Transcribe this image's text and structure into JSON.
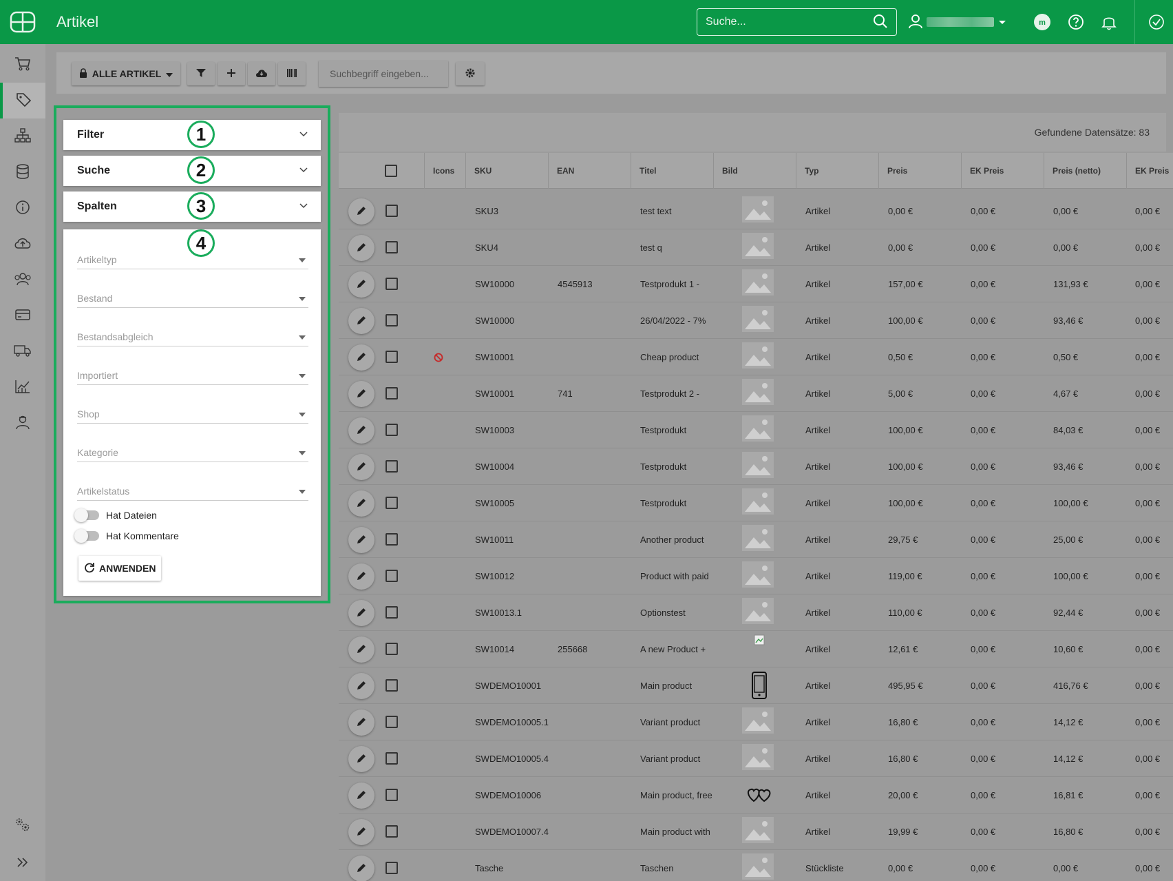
{
  "app": {
    "title": "Artikel"
  },
  "topbar": {
    "search_placeholder": "Suche..."
  },
  "toolbar": {
    "all_articles_label": "ALLE ARTIKEL",
    "search_placeholder": "Suchbegriff eingeben..."
  },
  "panel": {
    "sections": [
      {
        "label": "Filter",
        "badge": "1"
      },
      {
        "label": "Suche",
        "badge": "2"
      },
      {
        "label": "Spalten",
        "badge": "3"
      }
    ],
    "body_badge": "4",
    "selects": [
      "Artikeltyp",
      "Bestand",
      "Bestandsabgleich",
      "Importiert",
      "Shop",
      "Kategorie",
      "Artikelstatus"
    ],
    "toggles": [
      "Hat Dateien",
      "Hat Kommentare"
    ],
    "apply_label": "ANWENDEN"
  },
  "table": {
    "count_text": "Gefundene Datensätze: 83",
    "columns": [
      "Icons",
      "SKU",
      "EAN",
      "Titel",
      "Bild",
      "Typ",
      "Preis",
      "EK Preis",
      "Preis (netto)",
      "EK Preis"
    ],
    "rows": [
      {
        "sku": "SKU3",
        "ean": "",
        "title": "test text",
        "type": "Artikel",
        "price": "0,00 €",
        "ek": "0,00 €",
        "net": "0,00 €",
        "ek2": "0,00 €",
        "image": "placeholder",
        "icon": ""
      },
      {
        "sku": "SKU4",
        "ean": "",
        "title": "test q",
        "type": "Artikel",
        "price": "0,00 €",
        "ek": "0,00 €",
        "net": "0,00 €",
        "ek2": "0,00 €",
        "image": "placeholder",
        "icon": ""
      },
      {
        "sku": "SW10000",
        "ean": "4545913",
        "title": "Testprodukt 1 -",
        "type": "Artikel",
        "price": "157,00 €",
        "ek": "0,00 €",
        "net": "131,93 €",
        "ek2": "0,00 €",
        "image": "placeholder",
        "icon": ""
      },
      {
        "sku": "SW10000",
        "ean": "",
        "title": "26/04/2022 - 7%",
        "type": "Artikel",
        "price": "100,00 €",
        "ek": "0,00 €",
        "net": "93,46 €",
        "ek2": "0,00 €",
        "image": "placeholder",
        "icon": ""
      },
      {
        "sku": "SW10001",
        "ean": "",
        "title": "Cheap product",
        "type": "Artikel",
        "price": "0,50 €",
        "ek": "0,00 €",
        "net": "0,50 €",
        "ek2": "0,00 €",
        "image": "placeholder",
        "icon": "blocked-icon"
      },
      {
        "sku": "SW10001",
        "ean": "741",
        "title": "Testprodukt 2 -",
        "type": "Artikel",
        "price": "5,00 €",
        "ek": "0,00 €",
        "net": "4,67 €",
        "ek2": "0,00 €",
        "image": "placeholder",
        "icon": ""
      },
      {
        "sku": "SW10003",
        "ean": "",
        "title": "Testprodukt",
        "type": "Artikel",
        "price": "100,00 €",
        "ek": "0,00 €",
        "net": "84,03 €",
        "ek2": "0,00 €",
        "image": "placeholder",
        "icon": ""
      },
      {
        "sku": "SW10004",
        "ean": "",
        "title": "Testprodukt",
        "type": "Artikel",
        "price": "100,00 €",
        "ek": "0,00 €",
        "net": "93,46 €",
        "ek2": "0,00 €",
        "image": "placeholder",
        "icon": ""
      },
      {
        "sku": "SW10005",
        "ean": "",
        "title": "Testprodukt",
        "type": "Artikel",
        "price": "100,00 €",
        "ek": "0,00 €",
        "net": "100,00 €",
        "ek2": "0,00 €",
        "image": "placeholder",
        "icon": ""
      },
      {
        "sku": "SW10011",
        "ean": "",
        "title": "Another product",
        "type": "Artikel",
        "price": "29,75 €",
        "ek": "0,00 €",
        "net": "25,00 €",
        "ek2": "0,00 €",
        "image": "placeholder",
        "icon": ""
      },
      {
        "sku": "SW10012",
        "ean": "",
        "title": "Product with paid",
        "type": "Artikel",
        "price": "119,00 €",
        "ek": "0,00 €",
        "net": "100,00 €",
        "ek2": "0,00 €",
        "image": "placeholder",
        "icon": ""
      },
      {
        "sku": "SW10013.1",
        "ean": "",
        "title": "Optionstest",
        "type": "Artikel",
        "price": "110,00 €",
        "ek": "0,00 €",
        "net": "92,44 €",
        "ek2": "0,00 €",
        "image": "placeholder",
        "icon": ""
      },
      {
        "sku": "SW10014",
        "ean": "255668",
        "title": "A new Product +",
        "type": "Artikel",
        "price": "12,61 €",
        "ek": "0,00 €",
        "net": "10,60 €",
        "ek2": "0,00 €",
        "image": "broken",
        "icon": ""
      },
      {
        "sku": "SWDEMO10001",
        "ean": "",
        "title": "Main product",
        "type": "Artikel",
        "price": "495,95 €",
        "ek": "0,00 €",
        "net": "416,76 €",
        "ek2": "0,00 €",
        "image": "phone",
        "icon": ""
      },
      {
        "sku": "SWDEMO10005.1",
        "ean": "",
        "title": "Variant product",
        "type": "Artikel",
        "price": "16,80 €",
        "ek": "0,00 €",
        "net": "14,12 €",
        "ek2": "0,00 €",
        "image": "placeholder",
        "icon": ""
      },
      {
        "sku": "SWDEMO10005.4",
        "ean": "",
        "title": "Variant product",
        "type": "Artikel",
        "price": "16,80 €",
        "ek": "0,00 €",
        "net": "14,12 €",
        "ek2": "0,00 €",
        "image": "placeholder",
        "icon": ""
      },
      {
        "sku": "SWDEMO10006",
        "ean": "",
        "title": "Main product, free",
        "type": "Artikel",
        "price": "20,00 €",
        "ek": "0,00 €",
        "net": "16,81 €",
        "ek2": "0,00 €",
        "image": "hearts",
        "icon": ""
      },
      {
        "sku": "SWDEMO10007.4",
        "ean": "",
        "title": "Main product with",
        "type": "Artikel",
        "price": "19,99 €",
        "ek": "0,00 €",
        "net": "16,80 €",
        "ek2": "0,00 €",
        "image": "placeholder",
        "icon": ""
      },
      {
        "sku": "Tasche",
        "ean": "",
        "title": "Taschen",
        "type": "Stückliste",
        "price": "0,00 €",
        "ek": "0,00 €",
        "net": "0,00 €",
        "ek2": "0,00 €",
        "image": "placeholder",
        "icon": ""
      }
    ]
  },
  "colors": {
    "brand": "#0a9847",
    "highlight": "#1aac5c",
    "blocked": "#c62828"
  }
}
